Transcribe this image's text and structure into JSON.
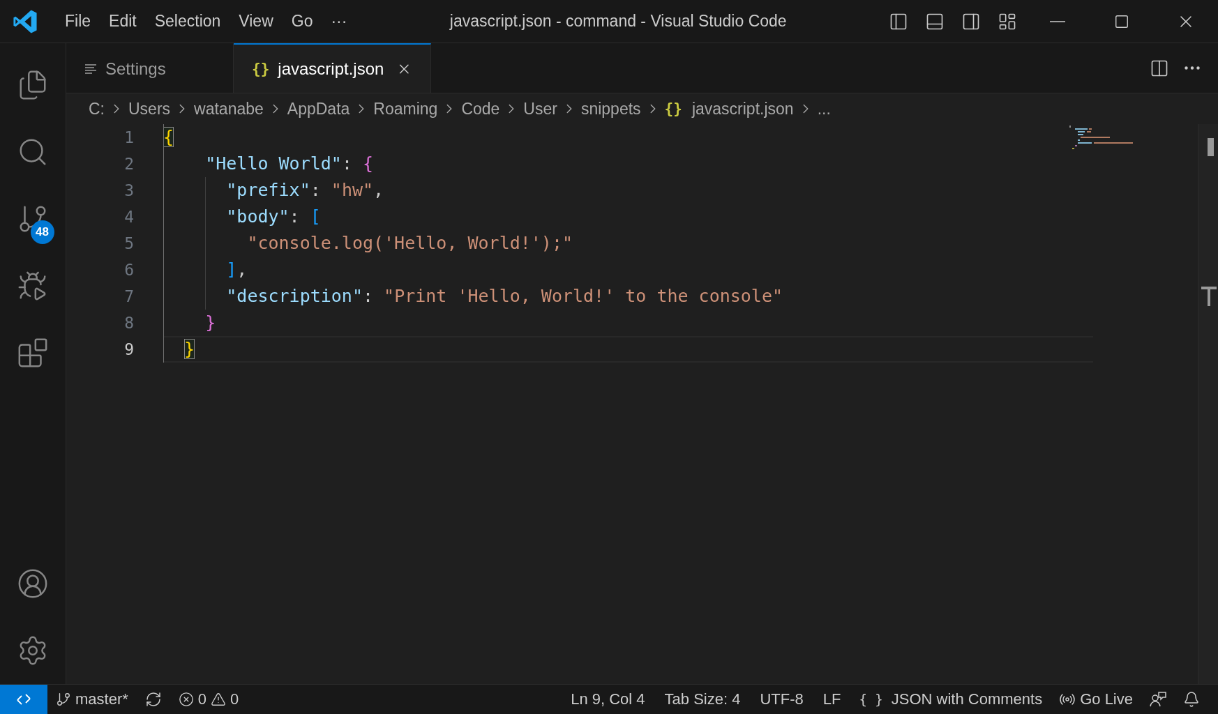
{
  "window": {
    "title": "javascript.json - command - Visual Studio Code"
  },
  "menu": [
    "File",
    "Edit",
    "Selection",
    "View",
    "Go",
    "···"
  ],
  "activity_bar": [
    {
      "kind": "explorer"
    },
    {
      "kind": "search"
    },
    {
      "kind": "scm",
      "badge": "48"
    },
    {
      "kind": "debug"
    },
    {
      "kind": "extensions"
    },
    {
      "kind": "spacer"
    },
    {
      "kind": "account"
    },
    {
      "kind": "manage"
    }
  ],
  "tabs": [
    {
      "label": "Settings",
      "kind": "settings",
      "selected": false
    },
    {
      "label": "javascript.json",
      "kind": "json",
      "icon": "{}",
      "selected": true
    }
  ],
  "breadcrumbs": [
    {
      "label": "C:"
    },
    {
      "label": "Users"
    },
    {
      "label": "watanabe"
    },
    {
      "label": "AppData"
    },
    {
      "label": "Roaming"
    },
    {
      "label": "Code"
    },
    {
      "label": "User"
    },
    {
      "label": "snippets"
    },
    {
      "label": "javascript.json",
      "icon": "{}"
    },
    {
      "label": "..."
    }
  ],
  "editor": {
    "lines": [
      {
        "number": "1",
        "current": false,
        "tokens": [
          {
            "kind": "bracket",
            "text": "{",
            "color": "#ffd700",
            "matched": true
          }
        ]
      },
      {
        "number": "2",
        "current": false,
        "tokens": [
          {
            "kind": "key",
            "text": "\"Hello World\""
          },
          {
            "kind": "plain",
            "text": ": "
          },
          {
            "kind": "bracket",
            "text": "{",
            "color": "#da70d6",
            "matched": false
          }
        ]
      },
      {
        "number": "3",
        "current": false,
        "tokens": [
          {
            "kind": "key",
            "text": "\"prefix\""
          },
          {
            "kind": "plain",
            "text": ": "
          },
          {
            "kind": "string",
            "text": "\"hw\""
          },
          {
            "kind": "plain",
            "text": ","
          }
        ]
      },
      {
        "number": "4",
        "current": false,
        "tokens": [
          {
            "kind": "key",
            "text": "\"body\""
          },
          {
            "kind": "plain",
            "text": ": "
          },
          {
            "kind": "bracket",
            "text": "[",
            "color": "#179fff",
            "matched": false
          }
        ]
      },
      {
        "number": "5",
        "current": false,
        "tokens": [
          {
            "kind": "string",
            "text": "\"console.log('Hello, World!');\""
          }
        ]
      },
      {
        "number": "6",
        "current": false,
        "tokens": [
          {
            "kind": "bracket",
            "text": "]",
            "color": "#179fff",
            "matched": false
          },
          {
            "kind": "plain",
            "text": ","
          }
        ]
      },
      {
        "number": "7",
        "current": false,
        "tokens": [
          {
            "kind": "key",
            "text": "\"description\""
          },
          {
            "kind": "plain",
            "text": ": "
          },
          {
            "kind": "string",
            "text": "\"Print 'Hello, World!' to the console\""
          }
        ]
      },
      {
        "number": "8",
        "current": false,
        "tokens": [
          {
            "kind": "bracket",
            "text": "}",
            "color": "#da70d6",
            "matched": false
          }
        ]
      },
      {
        "number": "9",
        "current": true,
        "tokens": [
          {
            "kind": "bracket",
            "text": "}",
            "color": "#ffd700",
            "matched": true
          }
        ]
      }
    ]
  },
  "status_bar": {
    "left": [
      {
        "kind": "branch",
        "text": "master*"
      },
      {
        "kind": "sync"
      },
      {
        "kind": "problems",
        "errors": "0",
        "warnings": "0"
      }
    ],
    "right": [
      {
        "kind": "text",
        "text": "Ln 9, Col 4"
      },
      {
        "kind": "text",
        "text": "Tab Size: 4"
      },
      {
        "kind": "text",
        "text": "UTF-8"
      },
      {
        "kind": "text",
        "text": "LF"
      },
      {
        "kind": "language",
        "icon": "{ }",
        "text": "JSON with Comments"
      },
      {
        "kind": "golive",
        "text": "Go Live"
      },
      {
        "kind": "feedback"
      },
      {
        "kind": "bell"
      }
    ]
  }
}
